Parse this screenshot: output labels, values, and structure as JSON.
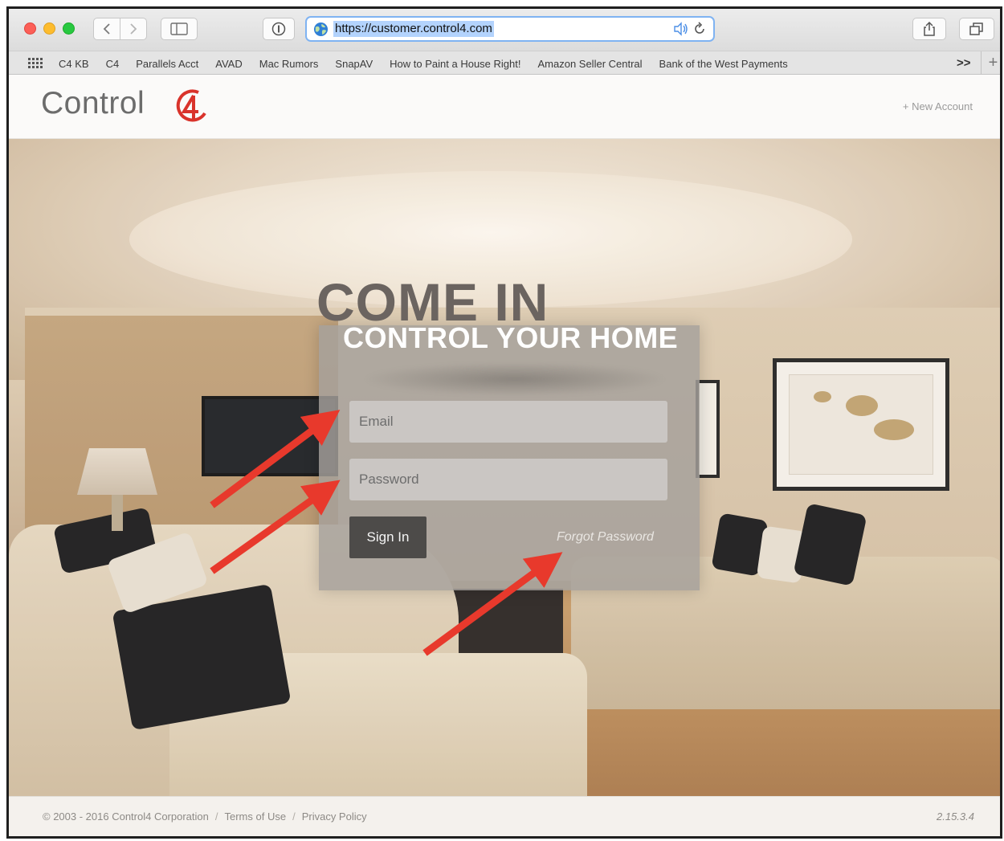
{
  "browser": {
    "url": "https://customer.control4.com",
    "bookmarks": [
      "C4 KB",
      "C4",
      "Parallels Acct",
      "AVAD",
      "Mac Rumors",
      "SnapAV",
      "How to Paint a House Right!",
      "Amazon Seller Central",
      "Bank of the West Payments"
    ],
    "more_label": ">>",
    "plus_label": "+"
  },
  "site": {
    "logo_text": "Control",
    "new_account": "+ New Account"
  },
  "login": {
    "headline": "COME IN",
    "subheadline": "CONTROL YOUR HOME",
    "email_placeholder": "Email",
    "password_placeholder": "Password",
    "sign_in": "Sign In",
    "forgot_password": "Forgot Password"
  },
  "footer": {
    "copyright": "© 2003 - 2016 Control4 Corporation",
    "terms": "Terms of Use",
    "privacy": "Privacy Policy",
    "version": "2.15.3.4"
  },
  "colors": {
    "annotation_arrow": "#e8392c",
    "brand_mark": "#d9332b"
  }
}
